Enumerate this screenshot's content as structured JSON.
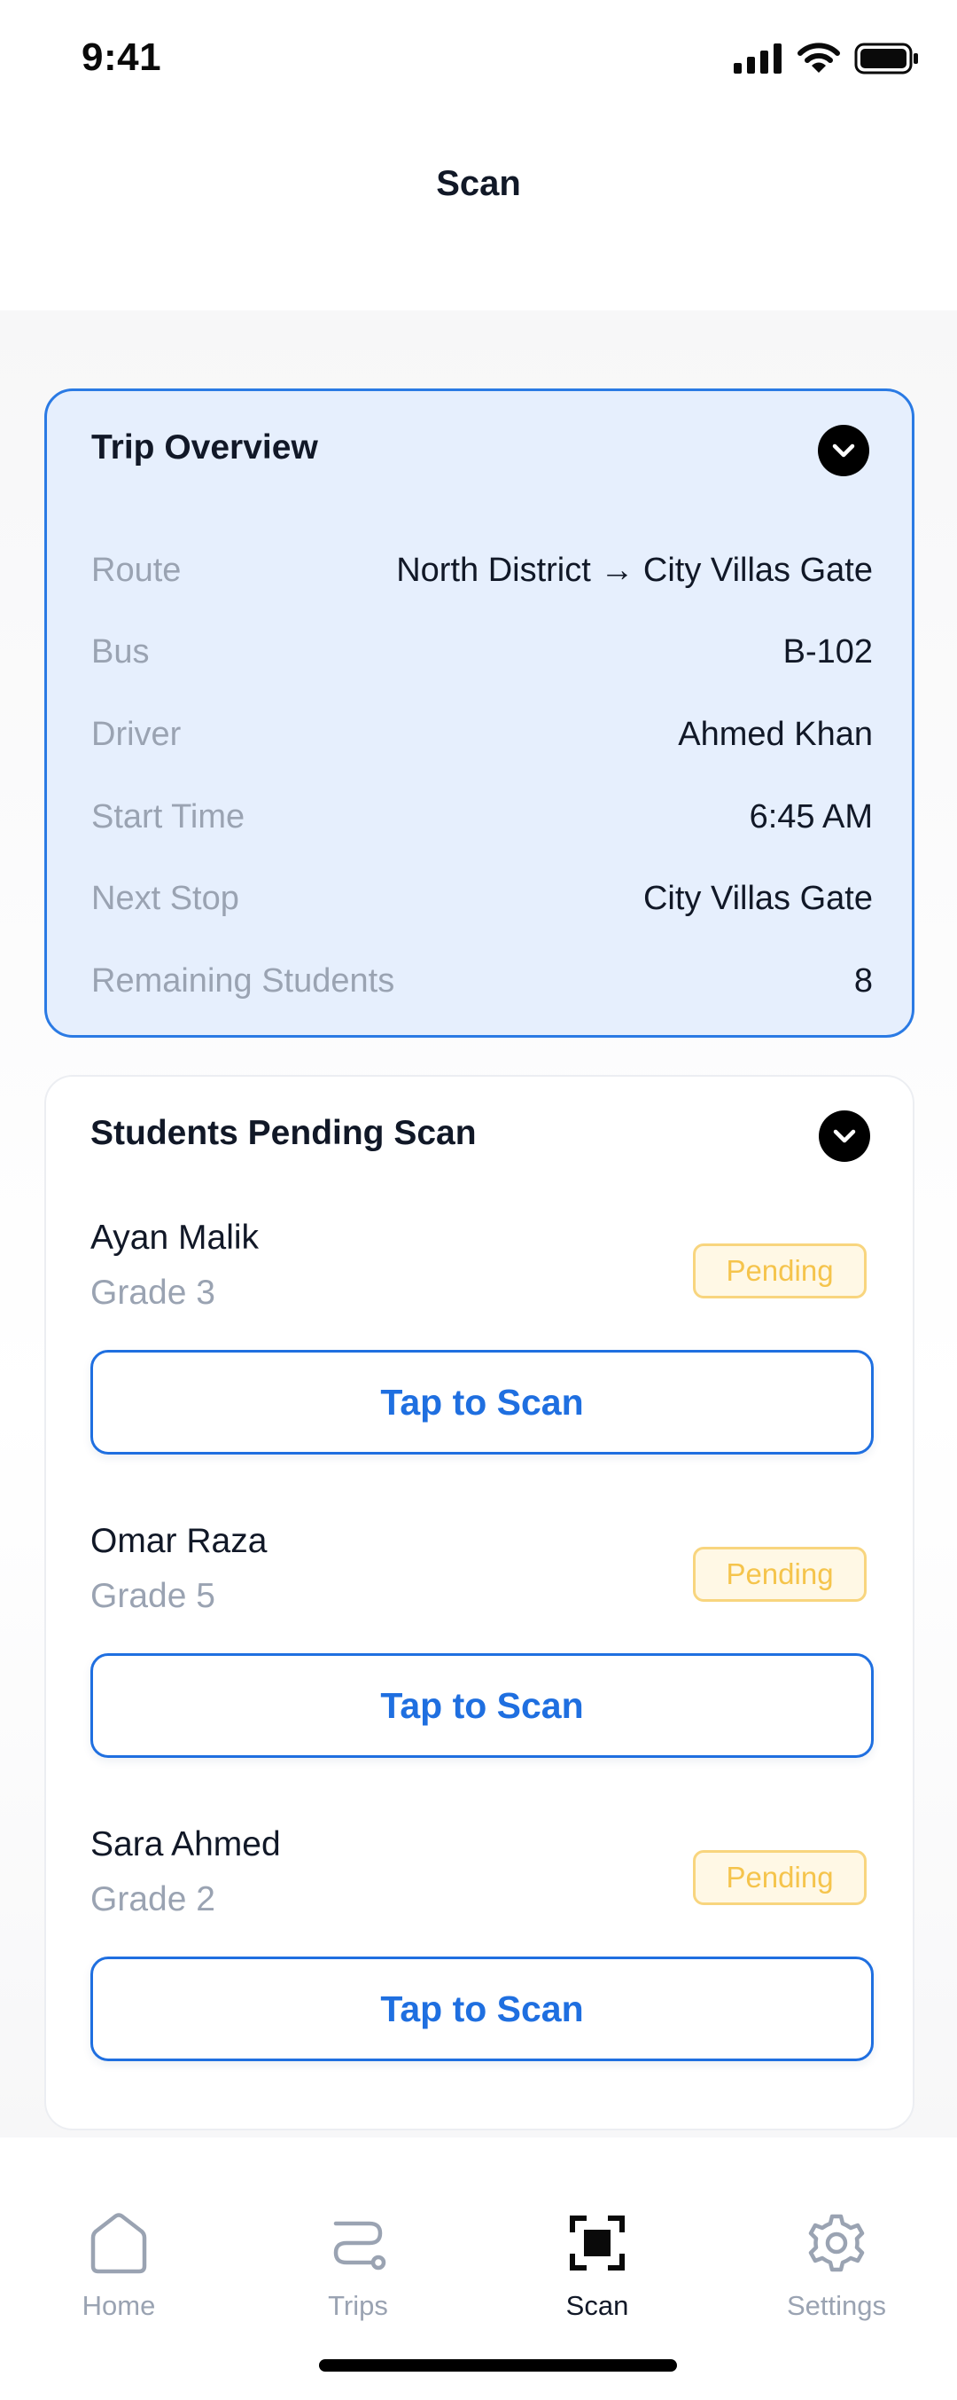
{
  "status_bar": {
    "time": "9:41"
  },
  "header": {
    "title": "Scan"
  },
  "trip_overview": {
    "title": "Trip Overview",
    "rows": [
      {
        "label": "Route",
        "value": "North District → City Villas Gate"
      },
      {
        "label": "Bus",
        "value": "B-102"
      },
      {
        "label": "Driver",
        "value": "Ahmed Khan"
      },
      {
        "label": "Start Time",
        "value": "6:45 AM"
      },
      {
        "label": "Next Stop",
        "value": "City Villas Gate"
      },
      {
        "label": "Remaining Students",
        "value": "8"
      }
    ]
  },
  "pending": {
    "title": "Students Pending Scan",
    "students": [
      {
        "name": "Ayan Malik",
        "grade": "Grade 3",
        "status": "Pending",
        "action": "Tap to Scan"
      },
      {
        "name": "Omar Raza",
        "grade": "Grade 5",
        "status": "Pending",
        "action": "Tap to Scan"
      },
      {
        "name": "Sara Ahmed",
        "grade": "Grade 2",
        "status": "Pending",
        "action": "Tap to Scan"
      }
    ]
  },
  "bottom_nav": {
    "items": [
      {
        "label": "Home",
        "icon": "home-icon"
      },
      {
        "label": "Trips",
        "icon": "route-icon"
      },
      {
        "label": "Scan",
        "icon": "scan-icon",
        "active": true
      },
      {
        "label": "Settings",
        "icon": "gear-icon"
      }
    ]
  },
  "colors": {
    "accent": "#1f6fe0",
    "overview_bg": "#e6effd",
    "pending_badge": "#f5c44c",
    "muted_text": "#9aa3b2"
  }
}
